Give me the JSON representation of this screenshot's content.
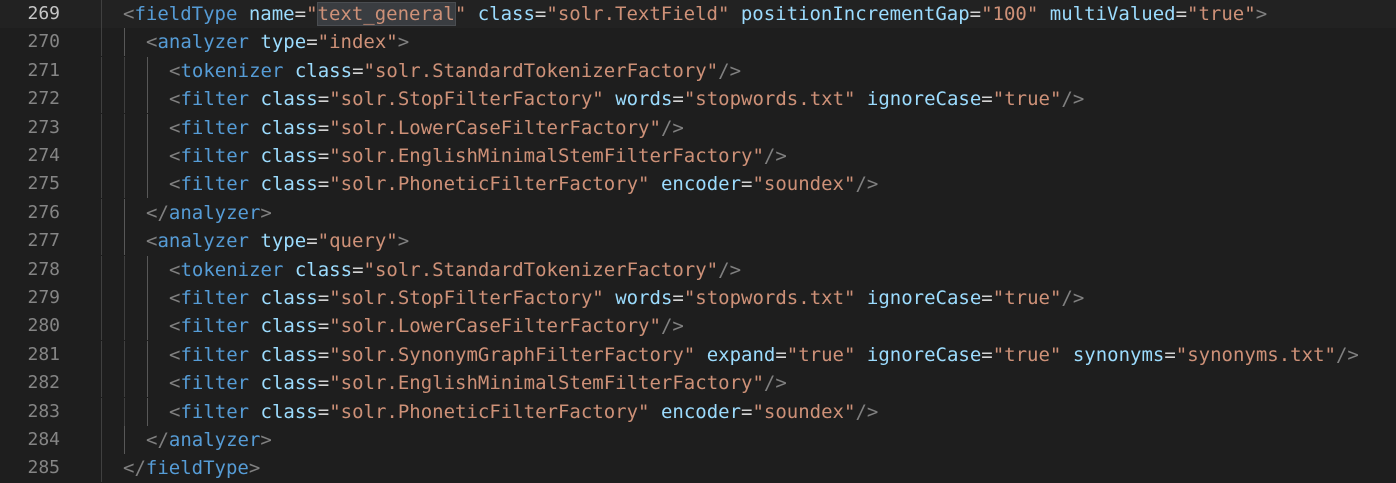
{
  "editor": {
    "language": "xml",
    "colors": {
      "background": "#1e1e1e",
      "line_number": "#858585",
      "punctuation": "#808080",
      "tag": "#569cd6",
      "attribute": "#9cdcfe",
      "string": "#ce9178"
    },
    "lines": [
      {
        "number": "269",
        "indent": 0,
        "tokens": [
          {
            "t": "p",
            "v": "<"
          },
          {
            "t": "t",
            "v": "fieldType"
          },
          {
            "t": "e",
            "v": " "
          },
          {
            "t": "a",
            "v": "name"
          },
          {
            "t": "e",
            "v": "="
          },
          {
            "t": "s",
            "v": "\""
          },
          {
            "t": "s",
            "v": "text_general",
            "hl": true
          },
          {
            "t": "s",
            "v": "\""
          },
          {
            "t": "e",
            "v": " "
          },
          {
            "t": "a",
            "v": "class"
          },
          {
            "t": "e",
            "v": "="
          },
          {
            "t": "s",
            "v": "\"solr.TextField\""
          },
          {
            "t": "e",
            "v": " "
          },
          {
            "t": "a",
            "v": "positionIncrementGap"
          },
          {
            "t": "e",
            "v": "="
          },
          {
            "t": "s",
            "v": "\"100\""
          },
          {
            "t": "e",
            "v": " "
          },
          {
            "t": "a",
            "v": "multiValued"
          },
          {
            "t": "e",
            "v": "="
          },
          {
            "t": "s",
            "v": "\"true\""
          },
          {
            "t": "p",
            "v": ">"
          }
        ]
      },
      {
        "number": "270",
        "indent": 1,
        "tokens": [
          {
            "t": "p",
            "v": "<"
          },
          {
            "t": "t",
            "v": "analyzer"
          },
          {
            "t": "e",
            "v": " "
          },
          {
            "t": "a",
            "v": "type"
          },
          {
            "t": "e",
            "v": "="
          },
          {
            "t": "s",
            "v": "\"index\""
          },
          {
            "t": "p",
            "v": ">"
          }
        ]
      },
      {
        "number": "271",
        "indent": 2,
        "tokens": [
          {
            "t": "p",
            "v": "<"
          },
          {
            "t": "t",
            "v": "tokenizer"
          },
          {
            "t": "e",
            "v": " "
          },
          {
            "t": "a",
            "v": "class"
          },
          {
            "t": "e",
            "v": "="
          },
          {
            "t": "s",
            "v": "\"solr.StandardTokenizerFactory\""
          },
          {
            "t": "p",
            "v": "/>"
          }
        ]
      },
      {
        "number": "272",
        "indent": 2,
        "tokens": [
          {
            "t": "p",
            "v": "<"
          },
          {
            "t": "t",
            "v": "filter"
          },
          {
            "t": "e",
            "v": " "
          },
          {
            "t": "a",
            "v": "class"
          },
          {
            "t": "e",
            "v": "="
          },
          {
            "t": "s",
            "v": "\"solr.StopFilterFactory\""
          },
          {
            "t": "e",
            "v": " "
          },
          {
            "t": "a",
            "v": "words"
          },
          {
            "t": "e",
            "v": "="
          },
          {
            "t": "s",
            "v": "\"stopwords.txt\""
          },
          {
            "t": "e",
            "v": " "
          },
          {
            "t": "a",
            "v": "ignoreCase"
          },
          {
            "t": "e",
            "v": "="
          },
          {
            "t": "s",
            "v": "\"true\""
          },
          {
            "t": "p",
            "v": "/>"
          }
        ]
      },
      {
        "number": "273",
        "indent": 2,
        "tokens": [
          {
            "t": "p",
            "v": "<"
          },
          {
            "t": "t",
            "v": "filter"
          },
          {
            "t": "e",
            "v": " "
          },
          {
            "t": "a",
            "v": "class"
          },
          {
            "t": "e",
            "v": "="
          },
          {
            "t": "s",
            "v": "\"solr.LowerCaseFilterFactory\""
          },
          {
            "t": "p",
            "v": "/>"
          }
        ]
      },
      {
        "number": "274",
        "indent": 2,
        "tokens": [
          {
            "t": "p",
            "v": "<"
          },
          {
            "t": "t",
            "v": "filter"
          },
          {
            "t": "e",
            "v": " "
          },
          {
            "t": "a",
            "v": "class"
          },
          {
            "t": "e",
            "v": "="
          },
          {
            "t": "s",
            "v": "\"solr.EnglishMinimalStemFilterFactory\""
          },
          {
            "t": "p",
            "v": "/>"
          }
        ]
      },
      {
        "number": "275",
        "indent": 2,
        "tokens": [
          {
            "t": "p",
            "v": "<"
          },
          {
            "t": "t",
            "v": "filter"
          },
          {
            "t": "e",
            "v": " "
          },
          {
            "t": "a",
            "v": "class"
          },
          {
            "t": "e",
            "v": "="
          },
          {
            "t": "s",
            "v": "\"solr.PhoneticFilterFactory\""
          },
          {
            "t": "e",
            "v": " "
          },
          {
            "t": "a",
            "v": "encoder"
          },
          {
            "t": "e",
            "v": "="
          },
          {
            "t": "s",
            "v": "\"soundex\""
          },
          {
            "t": "p",
            "v": "/>"
          }
        ]
      },
      {
        "number": "276",
        "indent": 1,
        "tokens": [
          {
            "t": "p",
            "v": "</"
          },
          {
            "t": "t",
            "v": "analyzer"
          },
          {
            "t": "p",
            "v": ">"
          }
        ]
      },
      {
        "number": "277",
        "indent": 1,
        "tokens": [
          {
            "t": "p",
            "v": "<"
          },
          {
            "t": "t",
            "v": "analyzer"
          },
          {
            "t": "e",
            "v": " "
          },
          {
            "t": "a",
            "v": "type"
          },
          {
            "t": "e",
            "v": "="
          },
          {
            "t": "s",
            "v": "\"query\""
          },
          {
            "t": "p",
            "v": ">"
          }
        ]
      },
      {
        "number": "278",
        "indent": 2,
        "tokens": [
          {
            "t": "p",
            "v": "<"
          },
          {
            "t": "t",
            "v": "tokenizer"
          },
          {
            "t": "e",
            "v": " "
          },
          {
            "t": "a",
            "v": "class"
          },
          {
            "t": "e",
            "v": "="
          },
          {
            "t": "s",
            "v": "\"solr.StandardTokenizerFactory\""
          },
          {
            "t": "p",
            "v": "/>"
          }
        ]
      },
      {
        "number": "279",
        "indent": 2,
        "tokens": [
          {
            "t": "p",
            "v": "<"
          },
          {
            "t": "t",
            "v": "filter"
          },
          {
            "t": "e",
            "v": " "
          },
          {
            "t": "a",
            "v": "class"
          },
          {
            "t": "e",
            "v": "="
          },
          {
            "t": "s",
            "v": "\"solr.StopFilterFactory\""
          },
          {
            "t": "e",
            "v": " "
          },
          {
            "t": "a",
            "v": "words"
          },
          {
            "t": "e",
            "v": "="
          },
          {
            "t": "s",
            "v": "\"stopwords.txt\""
          },
          {
            "t": "e",
            "v": " "
          },
          {
            "t": "a",
            "v": "ignoreCase"
          },
          {
            "t": "e",
            "v": "="
          },
          {
            "t": "s",
            "v": "\"true\""
          },
          {
            "t": "p",
            "v": "/>"
          }
        ]
      },
      {
        "number": "280",
        "indent": 2,
        "tokens": [
          {
            "t": "p",
            "v": "<"
          },
          {
            "t": "t",
            "v": "filter"
          },
          {
            "t": "e",
            "v": " "
          },
          {
            "t": "a",
            "v": "class"
          },
          {
            "t": "e",
            "v": "="
          },
          {
            "t": "s",
            "v": "\"solr.LowerCaseFilterFactory\""
          },
          {
            "t": "p",
            "v": "/>"
          }
        ]
      },
      {
        "number": "281",
        "indent": 2,
        "tokens": [
          {
            "t": "p",
            "v": "<"
          },
          {
            "t": "t",
            "v": "filter"
          },
          {
            "t": "e",
            "v": " "
          },
          {
            "t": "a",
            "v": "class"
          },
          {
            "t": "e",
            "v": "="
          },
          {
            "t": "s",
            "v": "\"solr.SynonymGraphFilterFactory\""
          },
          {
            "t": "e",
            "v": " "
          },
          {
            "t": "a",
            "v": "expand"
          },
          {
            "t": "e",
            "v": "="
          },
          {
            "t": "s",
            "v": "\"true\""
          },
          {
            "t": "e",
            "v": " "
          },
          {
            "t": "a",
            "v": "ignoreCase"
          },
          {
            "t": "e",
            "v": "="
          },
          {
            "t": "s",
            "v": "\"true\""
          },
          {
            "t": "e",
            "v": " "
          },
          {
            "t": "a",
            "v": "synonyms"
          },
          {
            "t": "e",
            "v": "="
          },
          {
            "t": "s",
            "v": "\"synonyms.txt\""
          },
          {
            "t": "p",
            "v": "/>"
          }
        ]
      },
      {
        "number": "282",
        "indent": 2,
        "tokens": [
          {
            "t": "p",
            "v": "<"
          },
          {
            "t": "t",
            "v": "filter"
          },
          {
            "t": "e",
            "v": " "
          },
          {
            "t": "a",
            "v": "class"
          },
          {
            "t": "e",
            "v": "="
          },
          {
            "t": "s",
            "v": "\"solr.EnglishMinimalStemFilterFactory\""
          },
          {
            "t": "p",
            "v": "/>"
          }
        ]
      },
      {
        "number": "283",
        "indent": 2,
        "tokens": [
          {
            "t": "p",
            "v": "<"
          },
          {
            "t": "t",
            "v": "filter"
          },
          {
            "t": "e",
            "v": " "
          },
          {
            "t": "a",
            "v": "class"
          },
          {
            "t": "e",
            "v": "="
          },
          {
            "t": "s",
            "v": "\"solr.PhoneticFilterFactory\""
          },
          {
            "t": "e",
            "v": " "
          },
          {
            "t": "a",
            "v": "encoder"
          },
          {
            "t": "e",
            "v": "="
          },
          {
            "t": "s",
            "v": "\"soundex\""
          },
          {
            "t": "p",
            "v": "/>"
          }
        ]
      },
      {
        "number": "284",
        "indent": 1,
        "tokens": [
          {
            "t": "p",
            "v": "</"
          },
          {
            "t": "t",
            "v": "analyzer"
          },
          {
            "t": "p",
            "v": ">"
          }
        ]
      },
      {
        "number": "285",
        "indent": 0,
        "tokens": [
          {
            "t": "p",
            "v": "</"
          },
          {
            "t": "t",
            "v": "fieldType"
          },
          {
            "t": "p",
            "v": ">"
          }
        ]
      }
    ]
  }
}
